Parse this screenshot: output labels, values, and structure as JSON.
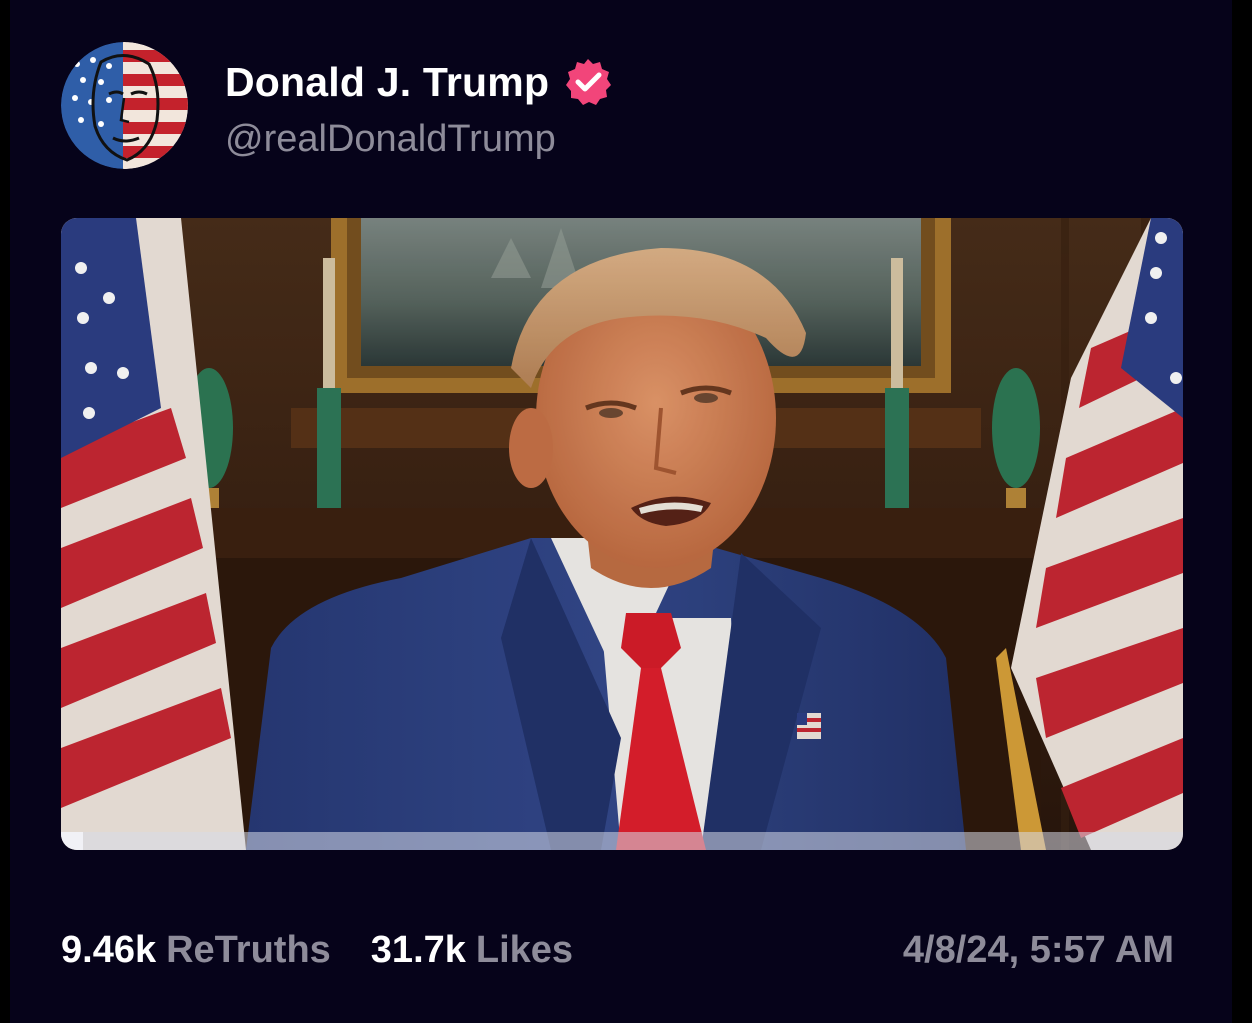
{
  "post": {
    "author": {
      "display_name": "Donald J. Trump",
      "handle": "@realDonaldTrump",
      "verified": true,
      "avatar_icon": "flag-face-avatar",
      "verified_icon": "verified-badge-icon"
    },
    "media": {
      "type": "video",
      "progress": 0.02
    },
    "stats": {
      "retruths_count": "9.46k",
      "retruths_label": "ReTruths",
      "likes_count": "31.7k",
      "likes_label": "Likes"
    },
    "timestamp": "4/8/24, 5:57 AM"
  },
  "colors": {
    "background": "#06031a",
    "text_primary": "#ffffff",
    "text_secondary": "#8e8c9a",
    "verified_badge": "#f2457a"
  }
}
